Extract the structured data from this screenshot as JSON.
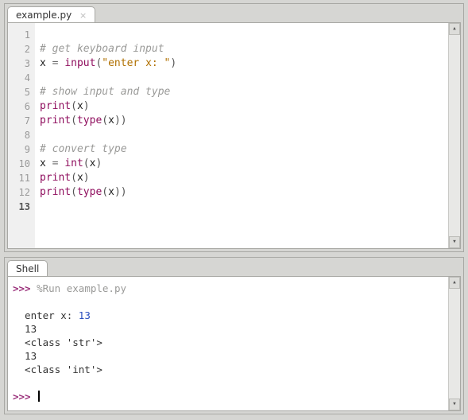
{
  "editor": {
    "tab_label": "example.py",
    "lines": [
      {
        "n": "1",
        "tokens": []
      },
      {
        "n": "2",
        "tokens": [
          {
            "t": "# get keyboard input",
            "c": "c-comment"
          }
        ]
      },
      {
        "n": "3",
        "tokens": [
          {
            "t": "x ",
            "c": "c-ident"
          },
          {
            "t": "=",
            "c": "c-op"
          },
          {
            "t": " ",
            "c": "c-ident"
          },
          {
            "t": "input",
            "c": "c-builtin"
          },
          {
            "t": "(",
            "c": "c-paren"
          },
          {
            "t": "\"enter x: \"",
            "c": "c-str"
          },
          {
            "t": ")",
            "c": "c-paren"
          }
        ]
      },
      {
        "n": "4",
        "tokens": []
      },
      {
        "n": "5",
        "tokens": [
          {
            "t": "# show input and type",
            "c": "c-comment"
          }
        ]
      },
      {
        "n": "6",
        "tokens": [
          {
            "t": "print",
            "c": "c-builtin"
          },
          {
            "t": "(",
            "c": "c-paren"
          },
          {
            "t": "x",
            "c": "c-ident"
          },
          {
            "t": ")",
            "c": "c-paren"
          }
        ]
      },
      {
        "n": "7",
        "tokens": [
          {
            "t": "print",
            "c": "c-builtin"
          },
          {
            "t": "(",
            "c": "c-paren"
          },
          {
            "t": "type",
            "c": "c-builtin"
          },
          {
            "t": "(",
            "c": "c-paren"
          },
          {
            "t": "x",
            "c": "c-ident"
          },
          {
            "t": ")",
            "c": "c-paren"
          },
          {
            "t": ")",
            "c": "c-paren"
          }
        ]
      },
      {
        "n": "8",
        "tokens": []
      },
      {
        "n": "9",
        "tokens": [
          {
            "t": "# convert type",
            "c": "c-comment"
          }
        ]
      },
      {
        "n": "10",
        "tokens": [
          {
            "t": "x ",
            "c": "c-ident"
          },
          {
            "t": "=",
            "c": "c-op"
          },
          {
            "t": " ",
            "c": "c-ident"
          },
          {
            "t": "int",
            "c": "c-builtin"
          },
          {
            "t": "(",
            "c": "c-paren"
          },
          {
            "t": "x",
            "c": "c-ident"
          },
          {
            "t": ")",
            "c": "c-paren"
          }
        ]
      },
      {
        "n": "11",
        "tokens": [
          {
            "t": "print",
            "c": "c-builtin"
          },
          {
            "t": "(",
            "c": "c-paren"
          },
          {
            "t": "x",
            "c": "c-ident"
          },
          {
            "t": ")",
            "c": "c-paren"
          }
        ]
      },
      {
        "n": "12",
        "tokens": [
          {
            "t": "print",
            "c": "c-builtin"
          },
          {
            "t": "(",
            "c": "c-paren"
          },
          {
            "t": "type",
            "c": "c-builtin"
          },
          {
            "t": "(",
            "c": "c-paren"
          },
          {
            "t": "x",
            "c": "c-ident"
          },
          {
            "t": ")",
            "c": "c-paren"
          },
          {
            "t": ")",
            "c": "c-paren"
          }
        ]
      },
      {
        "n": "13",
        "tokens": [],
        "current": true
      }
    ]
  },
  "shell": {
    "tab_label": "Shell",
    "lines": [
      {
        "segs": [
          {
            "t": ">>> ",
            "c": "sh-prompt"
          },
          {
            "t": "%Run example.py",
            "c": "sh-magic"
          }
        ]
      },
      {
        "segs": []
      },
      {
        "segs": [
          {
            "t": "  enter x: ",
            "c": "sh-out"
          },
          {
            "t": "13",
            "c": "sh-input"
          }
        ]
      },
      {
        "segs": [
          {
            "t": "  13",
            "c": "sh-out"
          }
        ]
      },
      {
        "segs": [
          {
            "t": "  <class 'str'>",
            "c": "sh-out"
          }
        ]
      },
      {
        "segs": [
          {
            "t": "  13",
            "c": "sh-out"
          }
        ]
      },
      {
        "segs": [
          {
            "t": "  <class 'int'>",
            "c": "sh-out"
          }
        ]
      },
      {
        "segs": []
      },
      {
        "segs": [
          {
            "t": ">>> ",
            "c": "sh-prompt"
          }
        ],
        "cursor": true
      }
    ]
  },
  "scroll": {
    "up": "▴",
    "down": "▾"
  }
}
